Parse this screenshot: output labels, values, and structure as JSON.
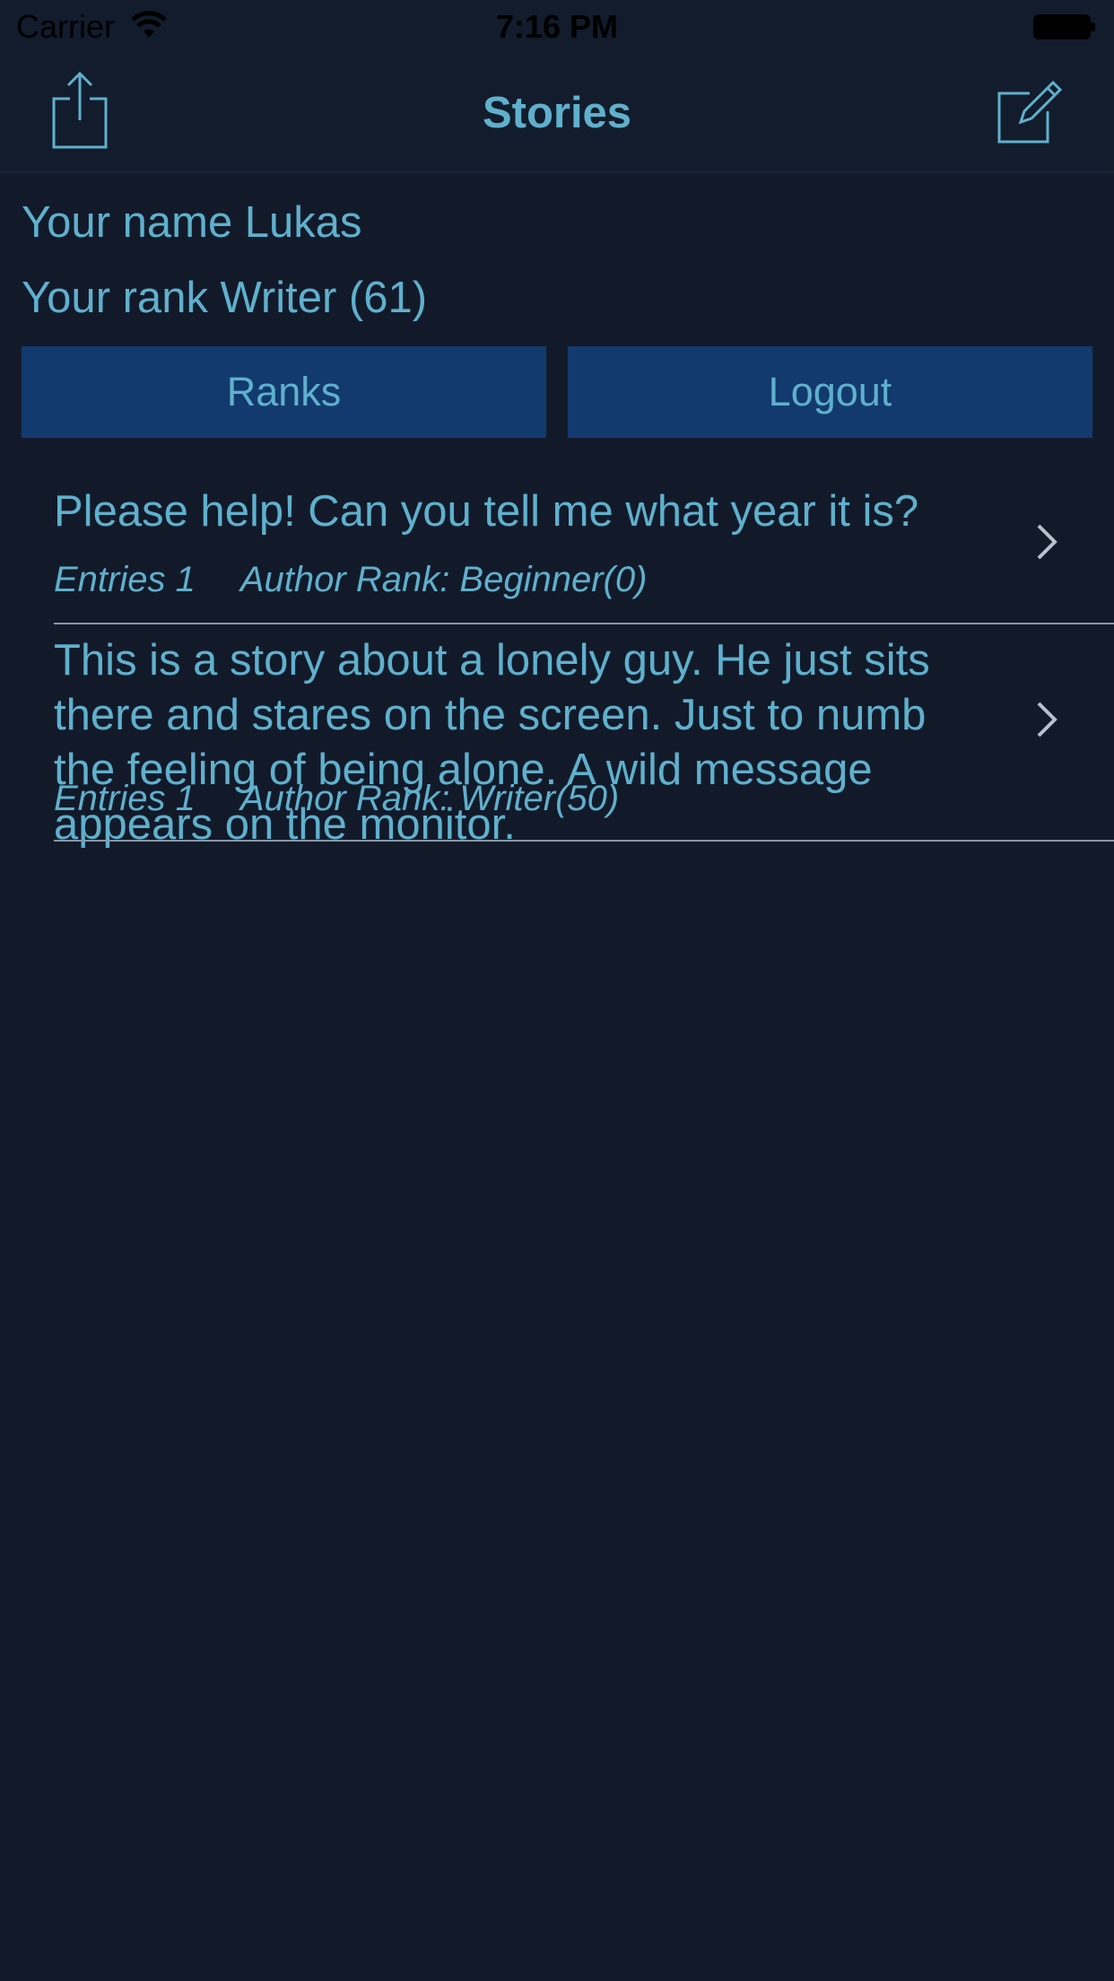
{
  "status_bar": {
    "carrier": "Carrier",
    "time": "7:16 PM"
  },
  "nav": {
    "title": "Stories",
    "share_icon": "share-icon",
    "compose_icon": "compose-icon"
  },
  "user": {
    "name_line": "Your name Lukas",
    "rank_line": "Your rank Writer (61)"
  },
  "buttons": {
    "ranks": "Ranks",
    "logout": "Logout"
  },
  "stories": [
    {
      "title": "Please help! Can you tell me what year it is?",
      "entries": "Entries 1",
      "author_rank": "Author Rank: Beginner(0)"
    },
    {
      "title": "This is a story about a lonely guy. He just sits there and stares on the screen. Just to numb the feeling of being alone. A wild message appears on the monitor.",
      "entries": "Entries 1",
      "author_rank": "Author Rank: Writer(50)"
    }
  ],
  "colors": {
    "background": "#121a2a",
    "accent": "#5fb0cc",
    "button_fill": "#123a6e"
  }
}
